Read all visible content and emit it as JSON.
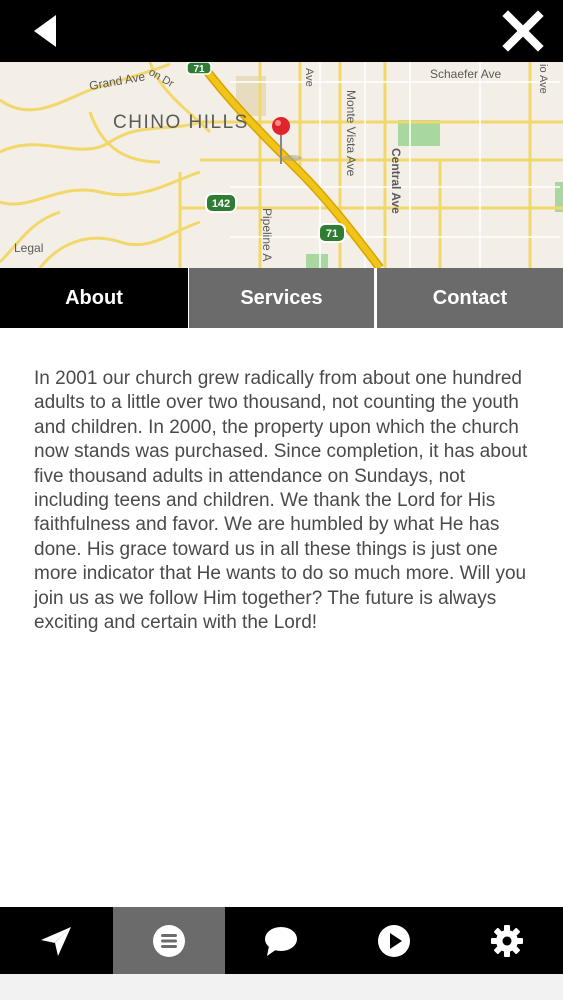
{
  "header": {
    "back_icon": "back-arrow-icon",
    "close_icon": "close-icon"
  },
  "map": {
    "labels": {
      "grand_ave": "Grand Ave",
      "chino_hills": "CHINO HILLS",
      "schaefer_ave": "Schaefer Ave",
      "monte_vista_ave": "Monte Vista Ave",
      "central_ave": "Central Ave",
      "pipeline_ave": "Pipeline A",
      "legal": "Legal",
      "route_71_top": "71",
      "route_142": "142",
      "route_71_bottom": "71",
      "top_left_street": "on Dr",
      "top_mid_street": "Ave",
      "top_right_street": "io Ave"
    },
    "pin_color": "#e0242b"
  },
  "tabs": [
    {
      "label": "About",
      "active": true
    },
    {
      "label": "Services",
      "active": false
    },
    {
      "label": "Contact",
      "active": false
    }
  ],
  "about": {
    "body": "In 2001 our church grew radically from about one hundred adults to a little over two thousand, not counting the youth and children. In 2000, the property upon which the church now stands was purchased. Since completion, it has about five thousand adults in attendance on Sundays, not including teens and children. We thank the Lord for His faithfulness and favor. We are humbled by what He has done. His grace toward us in all these things is just one more indicator that He wants to do so much more. Will you join us as we follow Him together? The future is always exciting and certain with the Lord!"
  },
  "bottom_nav": [
    {
      "icon": "send-icon",
      "active": false
    },
    {
      "icon": "menu-list-icon",
      "active": true
    },
    {
      "icon": "chat-bubble-icon",
      "active": false
    },
    {
      "icon": "play-icon",
      "active": false
    },
    {
      "icon": "gear-icon",
      "active": false
    }
  ],
  "colors": {
    "bar_black": "#000000",
    "tab_inactive": "#6b6b6b",
    "text": "#4a4a4a",
    "map_bg": "#f3efe6",
    "road_yellow": "#f2d76b",
    "highway": "#f0c419",
    "park_green": "#a8d8a0"
  }
}
